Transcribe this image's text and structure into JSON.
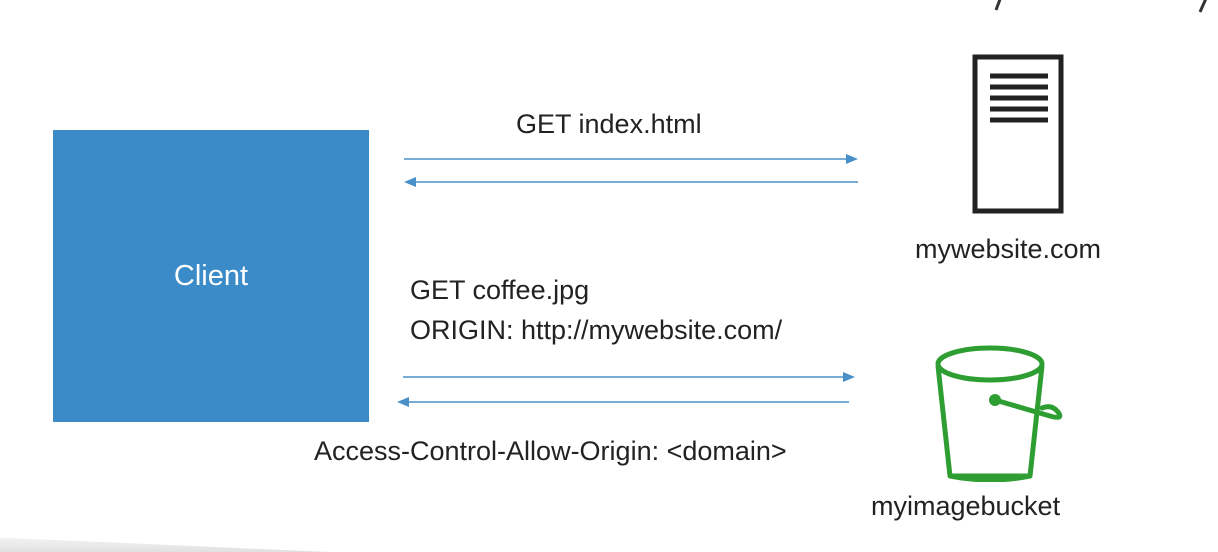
{
  "client": {
    "label": "Client"
  },
  "server": {
    "label": "mywebsite.com",
    "icon": "document-server-icon"
  },
  "bucket": {
    "label": "myimagebucket",
    "icon": "s3-bucket-icon",
    "color": "#2e9e33"
  },
  "requests": {
    "first": {
      "label": "GET index.html"
    },
    "second": {
      "line1": "GET coffee.jpg",
      "line2": "ORIGIN: http://mywebsite.com/"
    },
    "response": {
      "label": "Access-Control-Allow-Origin: <domain>"
    }
  },
  "colors": {
    "client_fill": "#3a8bc8",
    "arrow": "#4a90c8",
    "text": "#222222",
    "bucket": "#2e9e33"
  }
}
